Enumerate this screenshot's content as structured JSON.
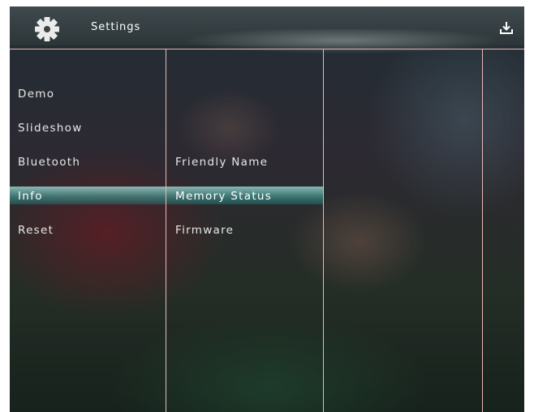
{
  "header": {
    "title": "Settings",
    "settings_icon": "gear-icon",
    "download_icon": "download-icon"
  },
  "column1": {
    "items": [
      "Demo",
      "Slideshow",
      "Bluetooth",
      "Info",
      "Reset"
    ],
    "selected": "Info"
  },
  "column2": {
    "items": [
      "Friendly Name",
      "Memory Status",
      "Firmware"
    ],
    "selected": "Memory Status"
  },
  "colors": {
    "divider": "#e8b9b6",
    "selection": "#5fb8b0"
  }
}
